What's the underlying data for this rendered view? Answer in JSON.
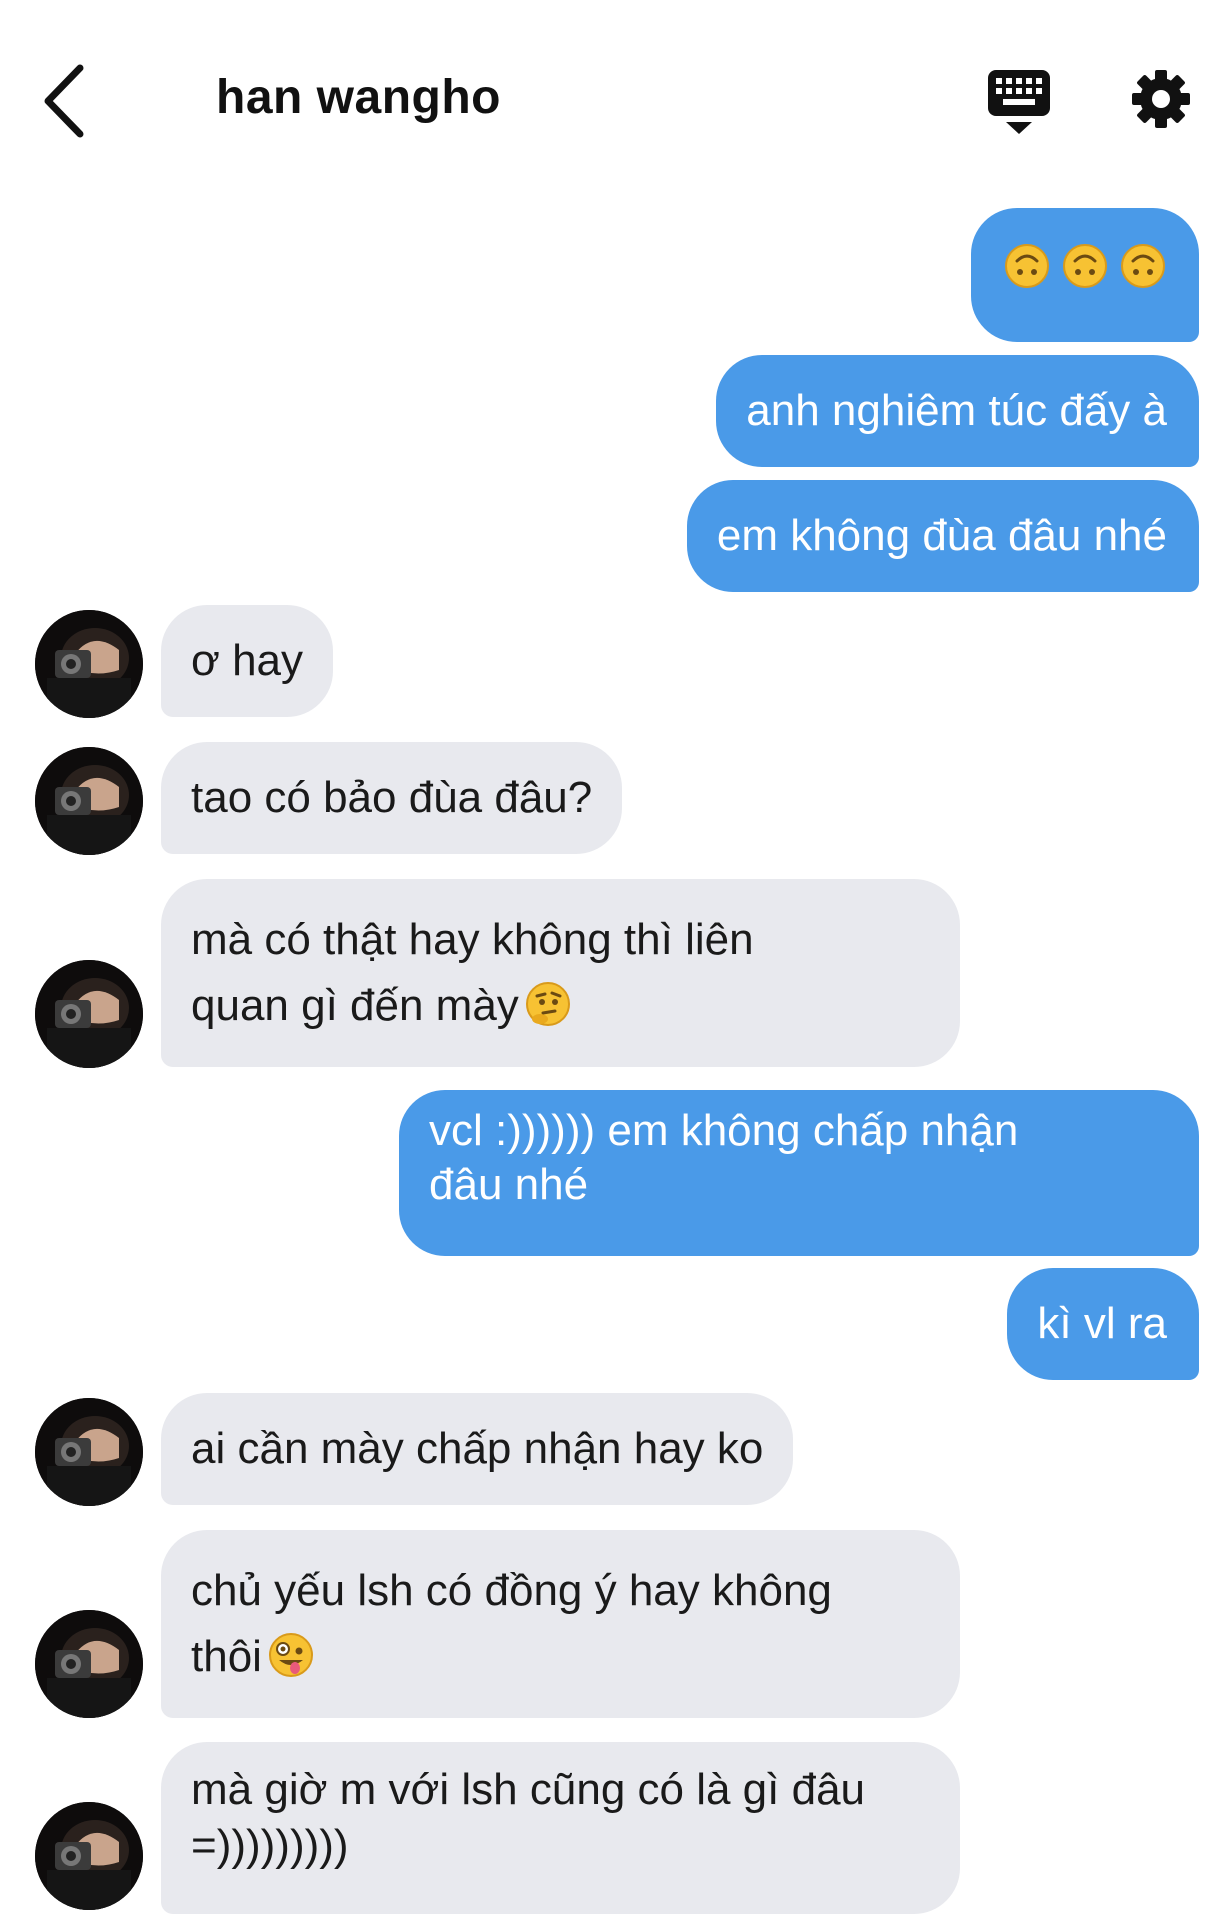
{
  "header": {
    "title": "han wangho",
    "back_icon": "chevron-left-icon",
    "keyboard_icon": "keyboard-icon",
    "settings_icon": "gear-icon"
  },
  "colors": {
    "outgoing_bubble": "#4a9ae8",
    "incoming_bubble": "#e8e9ee",
    "emoji_yellow": "#f7c233"
  },
  "messages": [
    {
      "side": "out",
      "text": "",
      "emoji": [
        "upside-down-face",
        "upside-down-face",
        "upside-down-face"
      ]
    },
    {
      "side": "out",
      "text": "anh nghiêm túc đấy à"
    },
    {
      "side": "out",
      "text": "em không đùa đâu nhé"
    },
    {
      "side": "in",
      "text": "ơ hay"
    },
    {
      "side": "in",
      "text": "tao có bảo đùa đâu?"
    },
    {
      "side": "in",
      "text": "mà có thật hay không thì liên\nquan gì đến mày",
      "emoji": [
        "thinking-face"
      ]
    },
    {
      "side": "out",
      "text": "vcl :)))))) em không chấp nhận\nđâu nhé"
    },
    {
      "side": "out",
      "text": "kì vl ra"
    },
    {
      "side": "in",
      "text": "ai cần mày chấp nhận hay ko"
    },
    {
      "side": "in",
      "text": "chủ yếu lsh có đồng ý hay không\nthôi",
      "emoji": [
        "zany-face"
      ]
    },
    {
      "side": "in",
      "text": "mà giờ m với lsh cũng có là gì đâu\n=)))))))))"
    }
  ]
}
